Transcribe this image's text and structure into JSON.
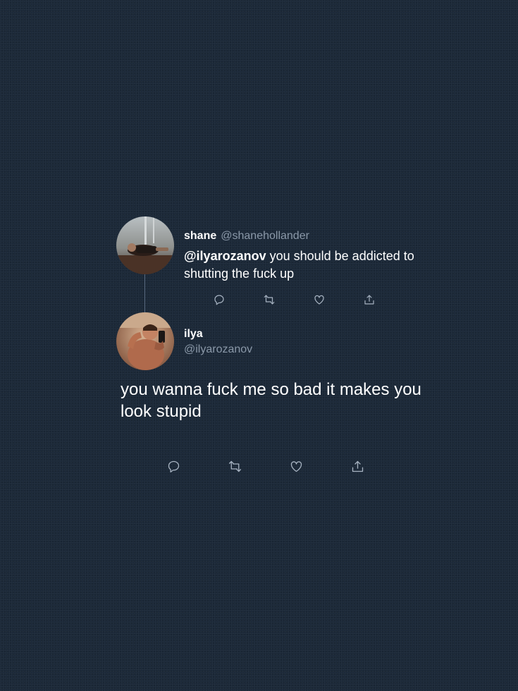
{
  "colors": {
    "background": "#1c2939",
    "text": "#ffffff",
    "muted": "#8a98a8",
    "icon": "#a8b4c2"
  },
  "reply": {
    "author_name": "shane",
    "author_handle": "@shanehollander",
    "mention": "@ilyarozanov",
    "text": " you should be addicted to shutting the fuck up",
    "actions": [
      "reply-icon",
      "retweet-icon",
      "like-icon",
      "share-icon"
    ]
  },
  "tweet": {
    "author_name": "ilya",
    "author_handle": "@ilyarozanov",
    "text": "you wanna fuck me so bad it makes you look stupid",
    "actions": [
      "reply-icon",
      "retweet-icon",
      "like-icon",
      "share-icon"
    ]
  }
}
